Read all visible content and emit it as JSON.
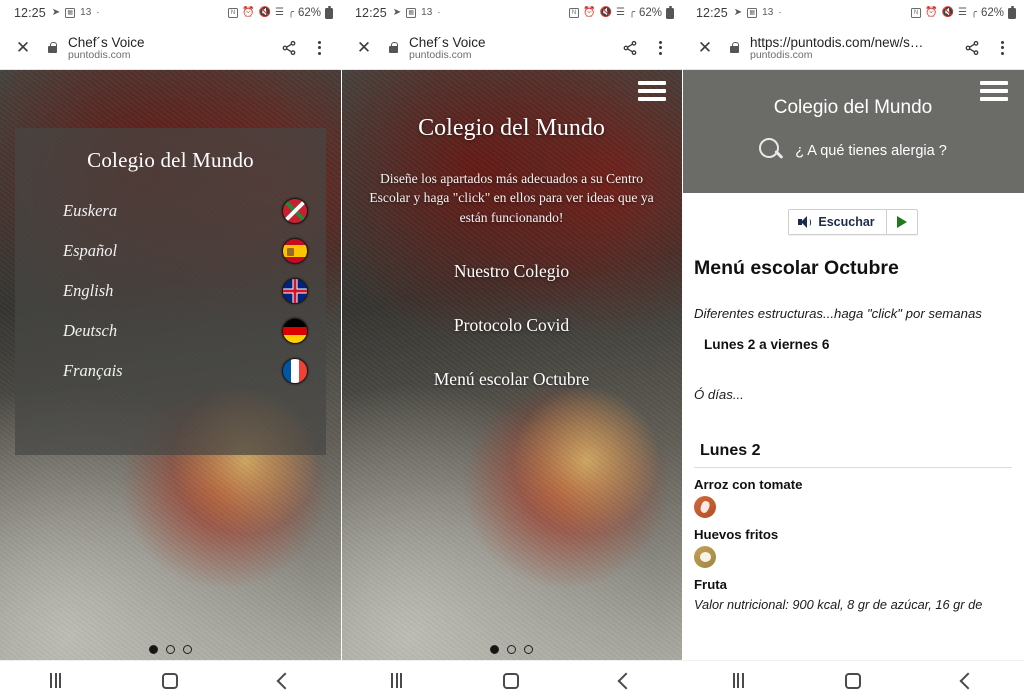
{
  "status_bar": {
    "time": "12:25",
    "left_icons": [
      "location-arrow-icon",
      "qr-icon",
      "calendar-13-icon",
      "dot-icon"
    ],
    "right_icons": [
      "nfc-icon",
      "alarm-icon",
      "mute-icon",
      "wifi-icon",
      "signal-icon"
    ],
    "battery": "62%"
  },
  "panels": [
    {
      "chrome": {
        "close_icon": "close-icon",
        "lock_icon": "lock-icon",
        "title": "Chef´s Voice",
        "host": "puntodis.com",
        "share_icon": "share-icon",
        "menu_icon": "kebab-menu-icon"
      },
      "card": {
        "title": "Colegio del Mundo",
        "languages": [
          {
            "label": "Euskera",
            "flag": "flag-basque-icon"
          },
          {
            "label": "Español",
            "flag": "flag-spain-icon"
          },
          {
            "label": "English",
            "flag": "flag-uk-icon"
          },
          {
            "label": "Deutsch",
            "flag": "flag-germany-icon"
          },
          {
            "label": "Français",
            "flag": "flag-france-icon"
          }
        ]
      },
      "carousel": {
        "total": 3,
        "active": 1
      }
    },
    {
      "chrome": {
        "close_icon": "close-icon",
        "lock_icon": "lock-icon",
        "title": "Chef´s Voice",
        "host": "puntodis.com",
        "share_icon": "share-icon",
        "menu_icon": "kebab-menu-icon"
      },
      "page": {
        "menu_icon": "hamburger-menu-icon",
        "title": "Colegio del Mundo",
        "intro": "Diseñe los apartados más adecuados a su Centro Escolar y haga \"click\" en ellos para ver ideas que ya están funcionando!",
        "links": [
          "Nuestro Colegio",
          "Protocolo Covid",
          "Menú escolar Octubre"
        ]
      },
      "carousel": {
        "total": 3,
        "active": 1
      }
    },
    {
      "chrome": {
        "close_icon": "close-icon",
        "lock_icon": "lock-icon",
        "title": "https://puntodis.com/new/s…",
        "host": "puntodis.com",
        "share_icon": "share-icon",
        "menu_icon": "kebab-menu-icon"
      },
      "page": {
        "menu_icon": "hamburger-menu-icon",
        "title": "Colegio del Mundo",
        "allergy_icon": "magnifier-icon",
        "allergy_text": "¿ A qué tienes alergia ?",
        "listen": {
          "speaker_icon": "speaker-icon",
          "label": "Escuchar",
          "play_icon": "play-icon"
        },
        "heading": "Menú escolar Octubre",
        "note": "Diferentes estructuras...haga \"click\" por semanas",
        "week_link": "Lunes 2 a viernes 6",
        "or_days": "Ó días...",
        "day_heading": "Lunes 2",
        "dishes": [
          {
            "name": "Arroz con tomate",
            "allergen_icon": "gluten-allergen-icon",
            "allergen_type": "gluten"
          },
          {
            "name": "Huevos fritos",
            "allergen_icon": "egg-allergen-icon",
            "allergen_type": "egg"
          },
          {
            "name": "Fruta",
            "allergen_icon": "",
            "allergen_type": ""
          }
        ],
        "nutrition": "Valor nutricional: 900 kcal, 8 gr de azúcar, 16 gr de"
      }
    }
  ],
  "nav_bar": {
    "recents_icon": "recents-icon",
    "home_icon": "home-icon",
    "back_icon": "back-icon"
  },
  "colors": {
    "header_gray": "#6b6b68",
    "card_overlay": "rgba(70,70,68,.72)",
    "play_green": "#1f7a1f",
    "listen_navy": "#1d2b4a"
  }
}
